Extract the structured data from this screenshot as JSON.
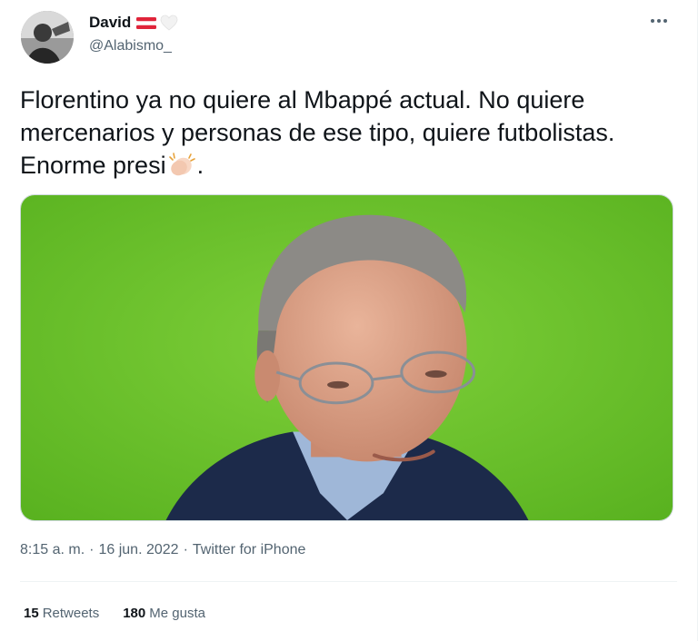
{
  "user": {
    "display_name": "David",
    "handle": "@Alabismo_",
    "flag_icon": "flag-austria-icon",
    "badge_icon": "white-heart-icon"
  },
  "tweet": {
    "text_before_emoji": "Florentino ya no quiere al Mbappé actual. No quiere mercenarios y personas de ese tipo, quiere futbolistas. Enorme presi",
    "emoji": "clapping-hands-icon",
    "text_after_emoji": "."
  },
  "meta": {
    "time": "8:15 a. m.",
    "separator": "·",
    "date": "16 jun. 2022",
    "source": "Twitter for iPhone"
  },
  "stats": {
    "retweets_count": "15",
    "retweets_label": "Retweets",
    "likes_count": "180",
    "likes_label": "Me gusta"
  },
  "colors": {
    "text_primary": "#0f1419",
    "text_secondary": "#536471",
    "pitch_green": "#6cc42c",
    "divider": "#eff3f4"
  }
}
